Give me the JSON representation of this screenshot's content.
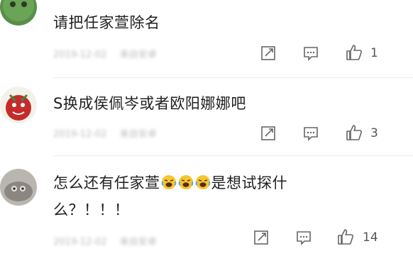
{
  "comments": [
    {
      "text": "请把任家萱除名",
      "meta_date": "2019-12-02",
      "meta_src": "来自安卓",
      "likes": "1"
    },
    {
      "text": "S换成侯佩岑或者欧阳娜娜吧",
      "meta_date": "2019-12-02",
      "meta_src": "来自安卓",
      "likes": "3"
    },
    {
      "text_part1": "怎么还有任家萱",
      "text_part2": "是想试探什",
      "text_line2": "么？！！！",
      "meta_date": "2019-12-02",
      "meta_src": "来自安卓",
      "likes": "14"
    }
  ],
  "icons": {
    "share": "share-icon",
    "comment": "comment-icon",
    "like": "thumbs-up-icon",
    "emoji": "crying-laugh-emoji"
  }
}
